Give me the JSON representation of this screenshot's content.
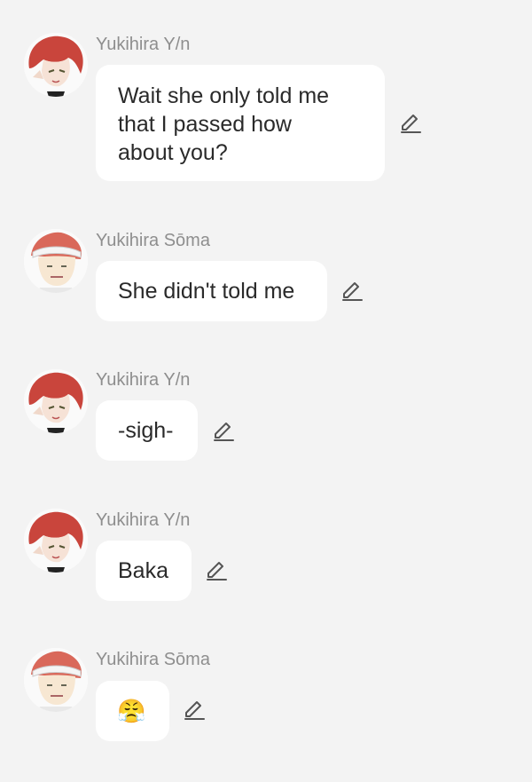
{
  "colors": {
    "background": "#f3f3f3",
    "bubble": "#ffffff",
    "sender_name": "#8e8e8e",
    "message_text": "#2a2a2a"
  },
  "messages": [
    {
      "sender": "Yukihira Y/n",
      "avatar": "red-haired-character-avatar",
      "text": "Wait she only told me\nthat I passed how\nabout you?",
      "action_icon": "pencil-edit-icon"
    },
    {
      "sender": "Yukihira Sōma",
      "avatar": "headband-character-avatar",
      "text": "She didn't told me",
      "action_icon": "pencil-edit-icon"
    },
    {
      "sender": "Yukihira Y/n",
      "avatar": "red-haired-character-avatar",
      "text": "-sigh-",
      "action_icon": "pencil-edit-icon"
    },
    {
      "sender": "Yukihira Y/n",
      "avatar": "red-haired-character-avatar",
      "text": "Baka",
      "action_icon": "pencil-edit-icon"
    },
    {
      "sender": "Yukihira Sōma",
      "avatar": "headband-character-avatar",
      "text": "😤",
      "action_icon": "pencil-edit-icon"
    }
  ]
}
